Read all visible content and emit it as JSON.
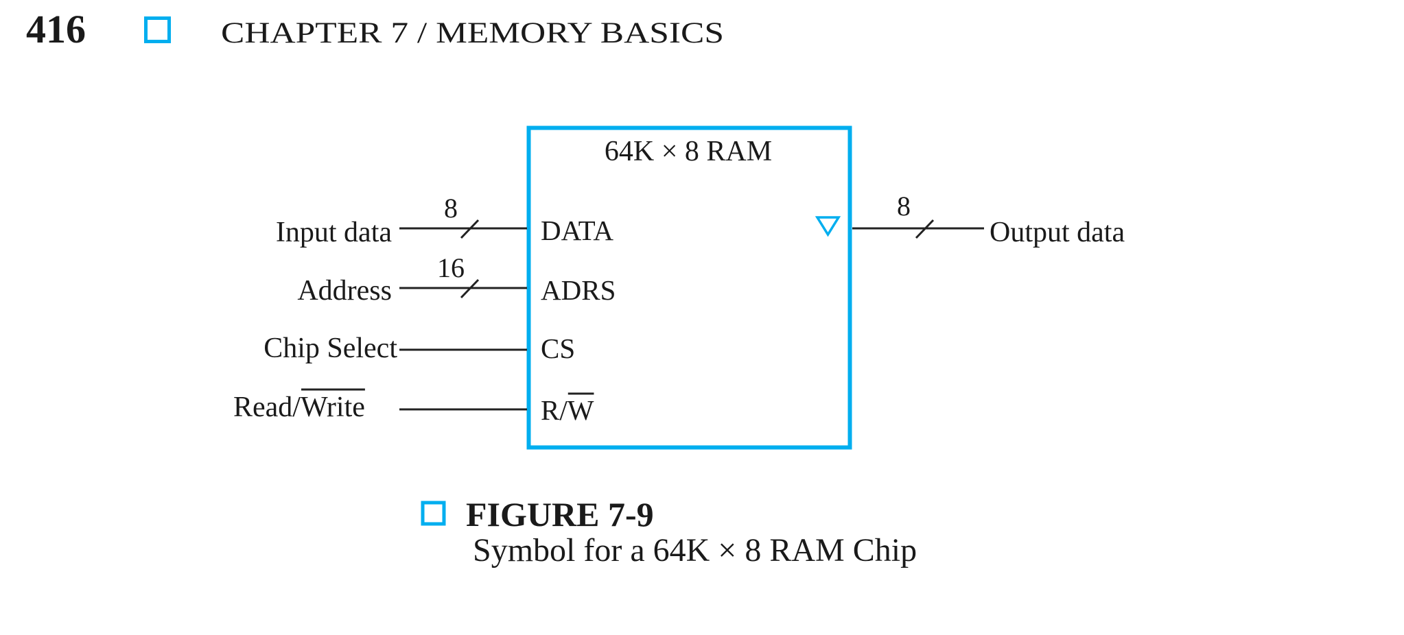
{
  "header": {
    "page_number": "416",
    "running_title": "CHAPTER 7 / MEMORY BASICS",
    "marker_icon": "hollow-square-icon",
    "accent_color": "#00AEEF"
  },
  "figure": {
    "chip": {
      "title": "64K × 8 RAM",
      "pins": {
        "data": "DATA",
        "address": "ADRS",
        "chip_select": "CS",
        "read_write_prefix": "R/",
        "read_write_overlined": "W"
      },
      "output_marker_icon": "three-state-triangle-icon"
    },
    "signals": {
      "input_data": {
        "label": "Input data",
        "width": "8"
      },
      "address": {
        "label": "Address",
        "width": "16"
      },
      "chip_select": {
        "label": "Chip Select"
      },
      "read_write": {
        "label_prefix": "Read/",
        "label_overlined": "Write"
      },
      "output_data": {
        "label": "Output data",
        "width": "8"
      }
    }
  },
  "caption": {
    "marker_icon": "hollow-square-icon",
    "figure_number": "FIGURE 7-9",
    "text": "Symbol for a 64K × 8 RAM Chip"
  }
}
